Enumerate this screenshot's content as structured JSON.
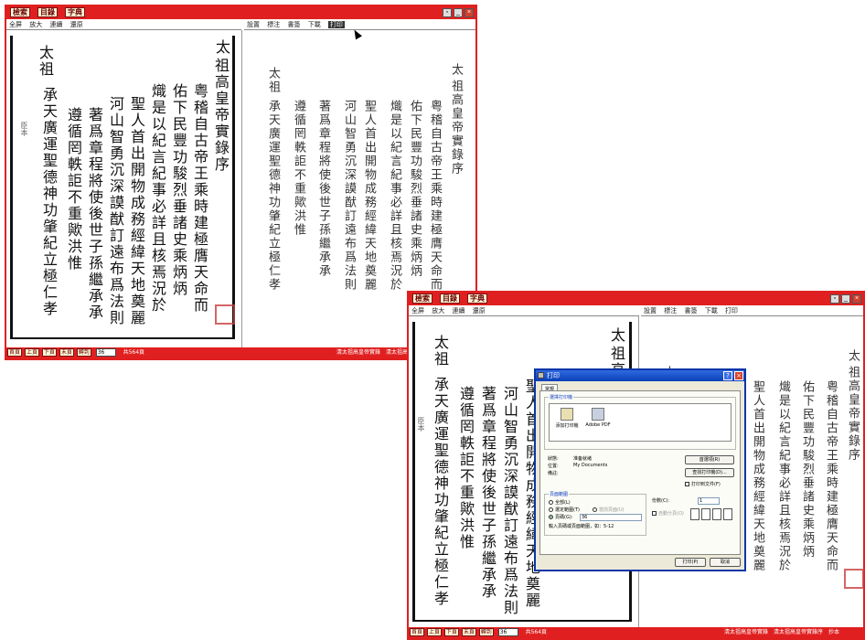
{
  "windows": [
    {
      "toolbar": [
        "檢索",
        "目錄",
        "字典"
      ],
      "left_menu": [
        "全屏",
        "放大",
        "連續",
        "還原"
      ],
      "right_menu": [
        "設置",
        "標注",
        "書簽",
        "下載",
        "打印"
      ],
      "right_menu_selected": "打印",
      "status": {
        "nav": [
          "首頁",
          "上頁",
          "下頁",
          "末頁",
          "轉到"
        ],
        "page_value": "36",
        "page_count": "共564頁",
        "crumbs": "清太祖高皇帝實錄　清太祖高皇帝實錄序　抄本"
      }
    },
    {
      "toolbar": [
        "檢索",
        "目錄",
        "字典"
      ],
      "left_menu": [
        "全屏",
        "放大",
        "連續",
        "還原"
      ],
      "right_menu": [
        "設置",
        "標注",
        "書簽",
        "下載",
        "打印"
      ],
      "status": {
        "nav": [
          "首頁",
          "上頁",
          "下頁",
          "末頁",
          "轉到"
        ],
        "page_value": "36",
        "page_count": "共564頁",
        "crumbs": "清太祖高皇帝實錄　清太祖高皇帝實錄序　抄本"
      }
    }
  ],
  "scan_text": {
    "heading_right": "太",
    "heading_title": "祖高皇帝實錄序",
    "columns_left": [
      "太祖",
      "承天廣運聖德神功肇紀立極仁孝",
      "遵循罔軼詎不重歟洪惟",
      "著爲章程將使後世子孫繼承承",
      "河山智勇沉深謨猷訂遠布爲法則",
      "聖人首出開物成務經緯天地奠麗",
      "熾是以紀言紀事必詳且核焉況於",
      "佑下民豐功駿烈垂諸史乘炳炳",
      "粤稽自古帝王乘時建極膺天命而"
    ],
    "margin_mark": "臣本"
  },
  "dialog": {
    "title": "打印",
    "tab": "常規",
    "group_printer": "選擇打印機",
    "printers": [
      {
        "label": "添加打印機",
        "icon": "add-printer-icon"
      },
      {
        "label": "Adobe PDF",
        "icon": "pdf-printer-icon"
      }
    ],
    "status_label": "狀態:",
    "status_value": "准备就绪",
    "location_label": "位置:",
    "location_value": "My Documents",
    "comment_label": "備註:",
    "preferences_button": "首選項(R)",
    "find_printer_button": "查找打印機(D)...",
    "print_to_file": "打印到文件(F)",
    "group_range": "頁面範圍",
    "range_all": "全部(L)",
    "range_selection": "選定範圍(T)",
    "range_current": "當前頁面(U)",
    "range_pages": "頁碼(G):",
    "pages_value": "36",
    "pages_hint": "輸入頁碼或頁面範圍，如：5-12",
    "copies_label": "份數(C):",
    "copies_value": "1",
    "collate_label": "自動分頁(O)",
    "print_button": "打印(P)",
    "cancel_button": "取消"
  },
  "colors": {
    "frame_red": "#e02020",
    "seal_red": "#c94040",
    "dialog_blue": "#0a36a8"
  }
}
